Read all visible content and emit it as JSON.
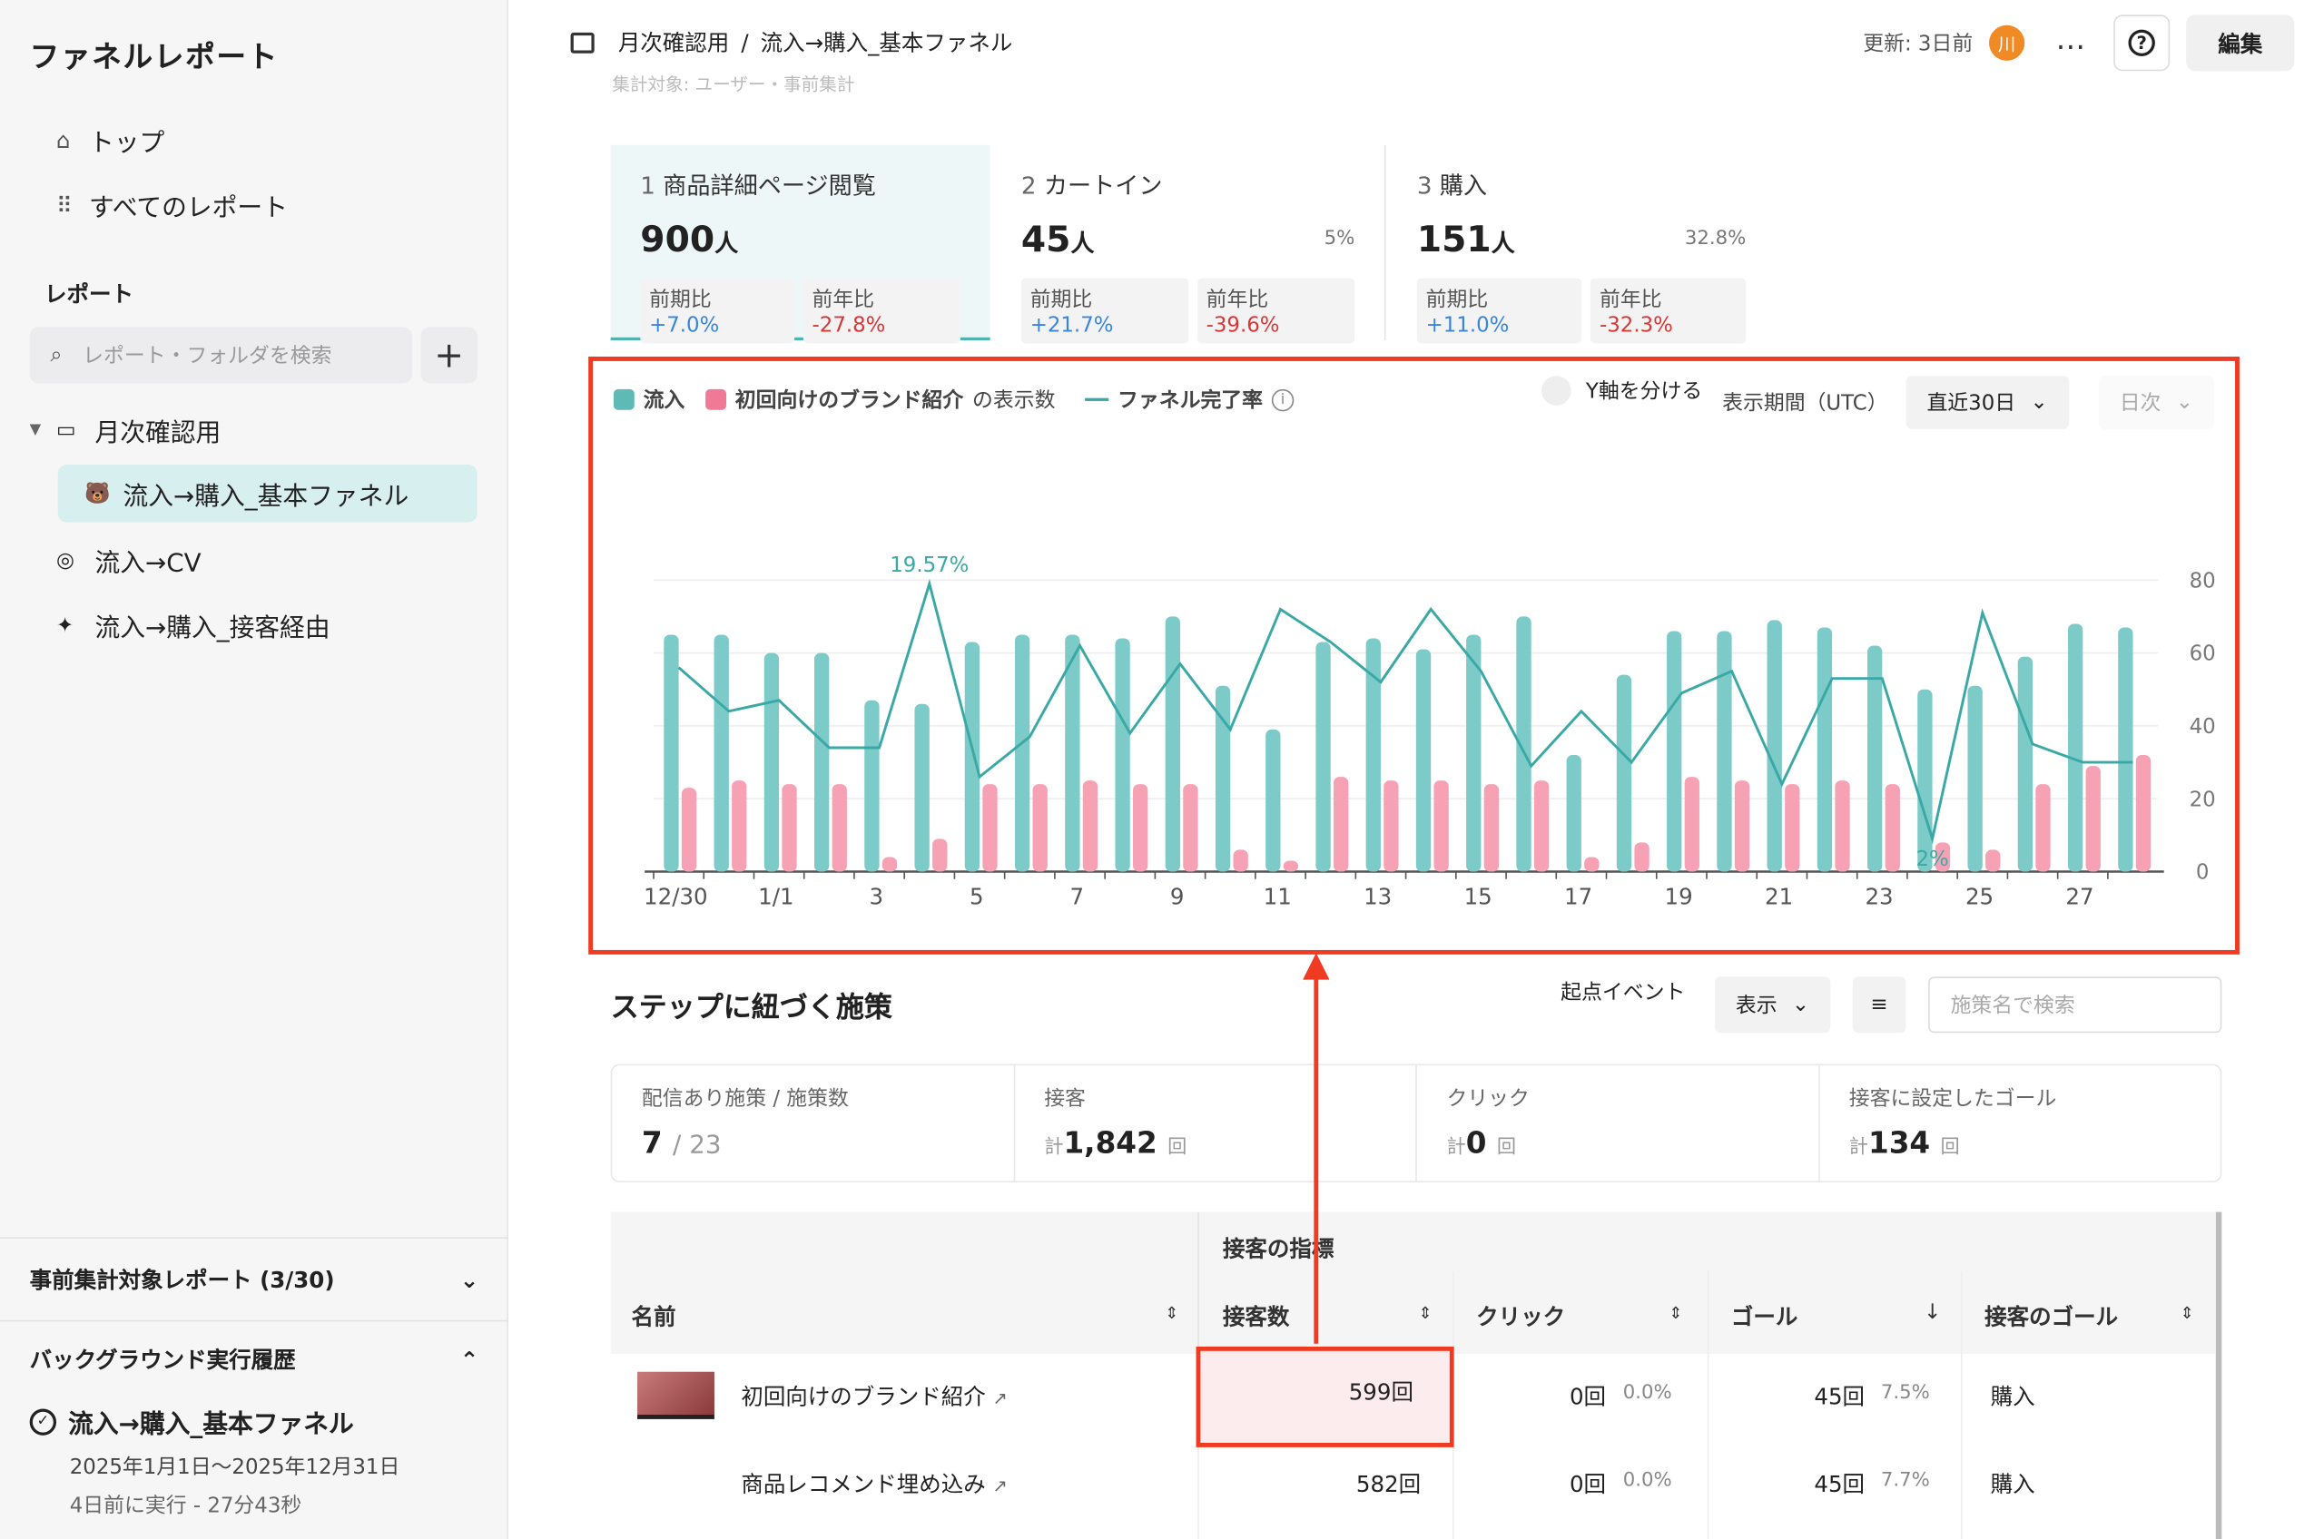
{
  "sidebar": {
    "title": "ファネルレポート",
    "nav": [
      {
        "label": "トップ",
        "icon": "home-icon"
      },
      {
        "label": "すべてのレポート",
        "icon": "grid-icon"
      }
    ],
    "section": "レポート",
    "search_placeholder": "レポート・フォルダを検索",
    "folder": "月次確認用",
    "items": [
      {
        "label": "流入→購入_基本ファネル",
        "icon": "bear-emoji-icon"
      },
      {
        "label": "流入→CV",
        "icon": "target-emoji-icon"
      },
      {
        "label": "流入→購入_接客経由",
        "icon": "popper-emoji-icon"
      }
    ],
    "precalc": "事前集計対象レポート (3/30)",
    "bg_history": "バックグラウンド実行履歴",
    "history": {
      "title": "流入→購入_基本ファネル",
      "range": "2025年1月1日〜2025年12月31日",
      "meta": "4日前に実行 - 27分43秒"
    }
  },
  "header": {
    "breadcrumb": [
      "月次確認用",
      "/",
      "流入→購入_基本ファネル"
    ],
    "updated": "更新: 3日前",
    "avatar": "川",
    "edit": "編集",
    "more": "…",
    "help": "?"
  },
  "ghost_text": "集計対象: ユーザー・事前集計",
  "steps": [
    {
      "num": "1",
      "name": "商品詳細ページ閲覧",
      "value": "900",
      "unit": "人",
      "pct": "",
      "mom_label": "前期比",
      "mom": "+7.0%",
      "yoy_label": "前年比",
      "yoy": "-27.8%"
    },
    {
      "num": "2",
      "name": "カートイン",
      "value": "45",
      "unit": "人",
      "pct": "5%",
      "mom_label": "前期比",
      "mom": "+21.7%",
      "yoy_label": "前年比",
      "yoy": "-39.6%"
    },
    {
      "num": "3",
      "name": "購入",
      "value": "151",
      "unit": "人",
      "pct": "32.8%",
      "mom_label": "前期比",
      "mom": "+11.0%",
      "yoy_label": "前年比",
      "yoy": "-32.3%"
    }
  ],
  "chart_controls": {
    "legend_inflow": "流入",
    "legend_brand": "初回向けのブランド紹介",
    "legend_brand_suffix": "の表示数",
    "legend_rate": "ファネル完了率",
    "split_y": "Y軸を分ける",
    "period_label": "表示期間（UTC）",
    "period": "直近30日",
    "granularity": "日次"
  },
  "chart_data": {
    "type": "bar",
    "categories": [
      "12/30",
      "12/31",
      "1/1",
      "1/2",
      "1/3",
      "1/4",
      "1/5",
      "1/6",
      "1/7",
      "1/8",
      "1/9",
      "1/10",
      "1/11",
      "1/12",
      "1/13",
      "1/14",
      "1/15",
      "1/16",
      "1/17",
      "1/18",
      "1/19",
      "1/20",
      "1/21",
      "1/22",
      "1/23",
      "1/24",
      "1/25",
      "1/26",
      "1/27",
      "1/28"
    ],
    "tick_labels": [
      "12/30",
      "1/1",
      "3",
      "5",
      "7",
      "9",
      "11",
      "13",
      "15",
      "17",
      "19",
      "21",
      "23",
      "25",
      "27"
    ],
    "series": [
      {
        "name": "流入",
        "color": "#7ccbc8",
        "values": [
          65,
          65,
          60,
          60,
          47,
          46,
          63,
          65,
          65,
          64,
          70,
          51,
          39,
          63,
          64,
          61,
          65,
          70,
          32,
          54,
          66,
          66,
          69,
          67,
          62,
          50,
          51,
          59,
          68,
          67
        ]
      },
      {
        "name": "初回向けのブランド紹介",
        "color": "#f7a1b5",
        "values": [
          23,
          25,
          24,
          24,
          4,
          9,
          24,
          24,
          25,
          24,
          24,
          6,
          3,
          26,
          25,
          25,
          24,
          25,
          4,
          8,
          26,
          25,
          24,
          25,
          24,
          8,
          6,
          24,
          29,
          32
        ]
      },
      {
        "name": "ファネル完了率",
        "color": "#3aa9a6",
        "values": [
          56,
          44,
          47,
          34,
          34,
          79,
          26,
          37,
          62,
          38,
          57,
          39,
          72,
          63,
          52,
          72,
          55,
          29,
          44,
          30,
          49,
          55,
          24,
          53,
          53,
          9,
          71,
          35,
          30,
          30
        ]
      }
    ],
    "annotations": [
      "19.57%",
      "2%"
    ],
    "yticks": [
      "0",
      "20",
      "40",
      "60",
      "80"
    ],
    "ylim": [
      0,
      80
    ]
  },
  "tactics": {
    "title": "ステップに紐づく施策",
    "origin_label": "起点イベント",
    "show": "表示",
    "search_placeholder": "施策名で検索",
    "stats": [
      {
        "label": "配信あり施策 / 施策数",
        "value": "7",
        "suffix": "/ 23",
        "prefix": ""
      },
      {
        "label": "接客",
        "prefix": "計",
        "value": "1,842",
        "suffix": "回"
      },
      {
        "label": "クリック",
        "prefix": "計",
        "value": "0",
        "suffix": "回"
      },
      {
        "label": "接客に設定したゴール",
        "prefix": "計",
        "value": "134",
        "suffix": "回"
      }
    ],
    "table": {
      "group": "接客の指標",
      "cols": [
        "名前",
        "接客数",
        "クリック",
        "ゴール",
        "接客のゴール"
      ],
      "rows": [
        {
          "name": "初回向けのブランド紹介",
          "count": "599回",
          "click": "0回",
          "click_pct": "0.0%",
          "goal": "45回",
          "goal_pct": "7.5%",
          "goal_name": "購入"
        },
        {
          "name": "商品レコメンド埋め込み",
          "count": "582回",
          "click": "0回",
          "click_pct": "0.0%",
          "goal": "45回",
          "goal_pct": "7.7%",
          "goal_name": "購入"
        }
      ]
    }
  }
}
